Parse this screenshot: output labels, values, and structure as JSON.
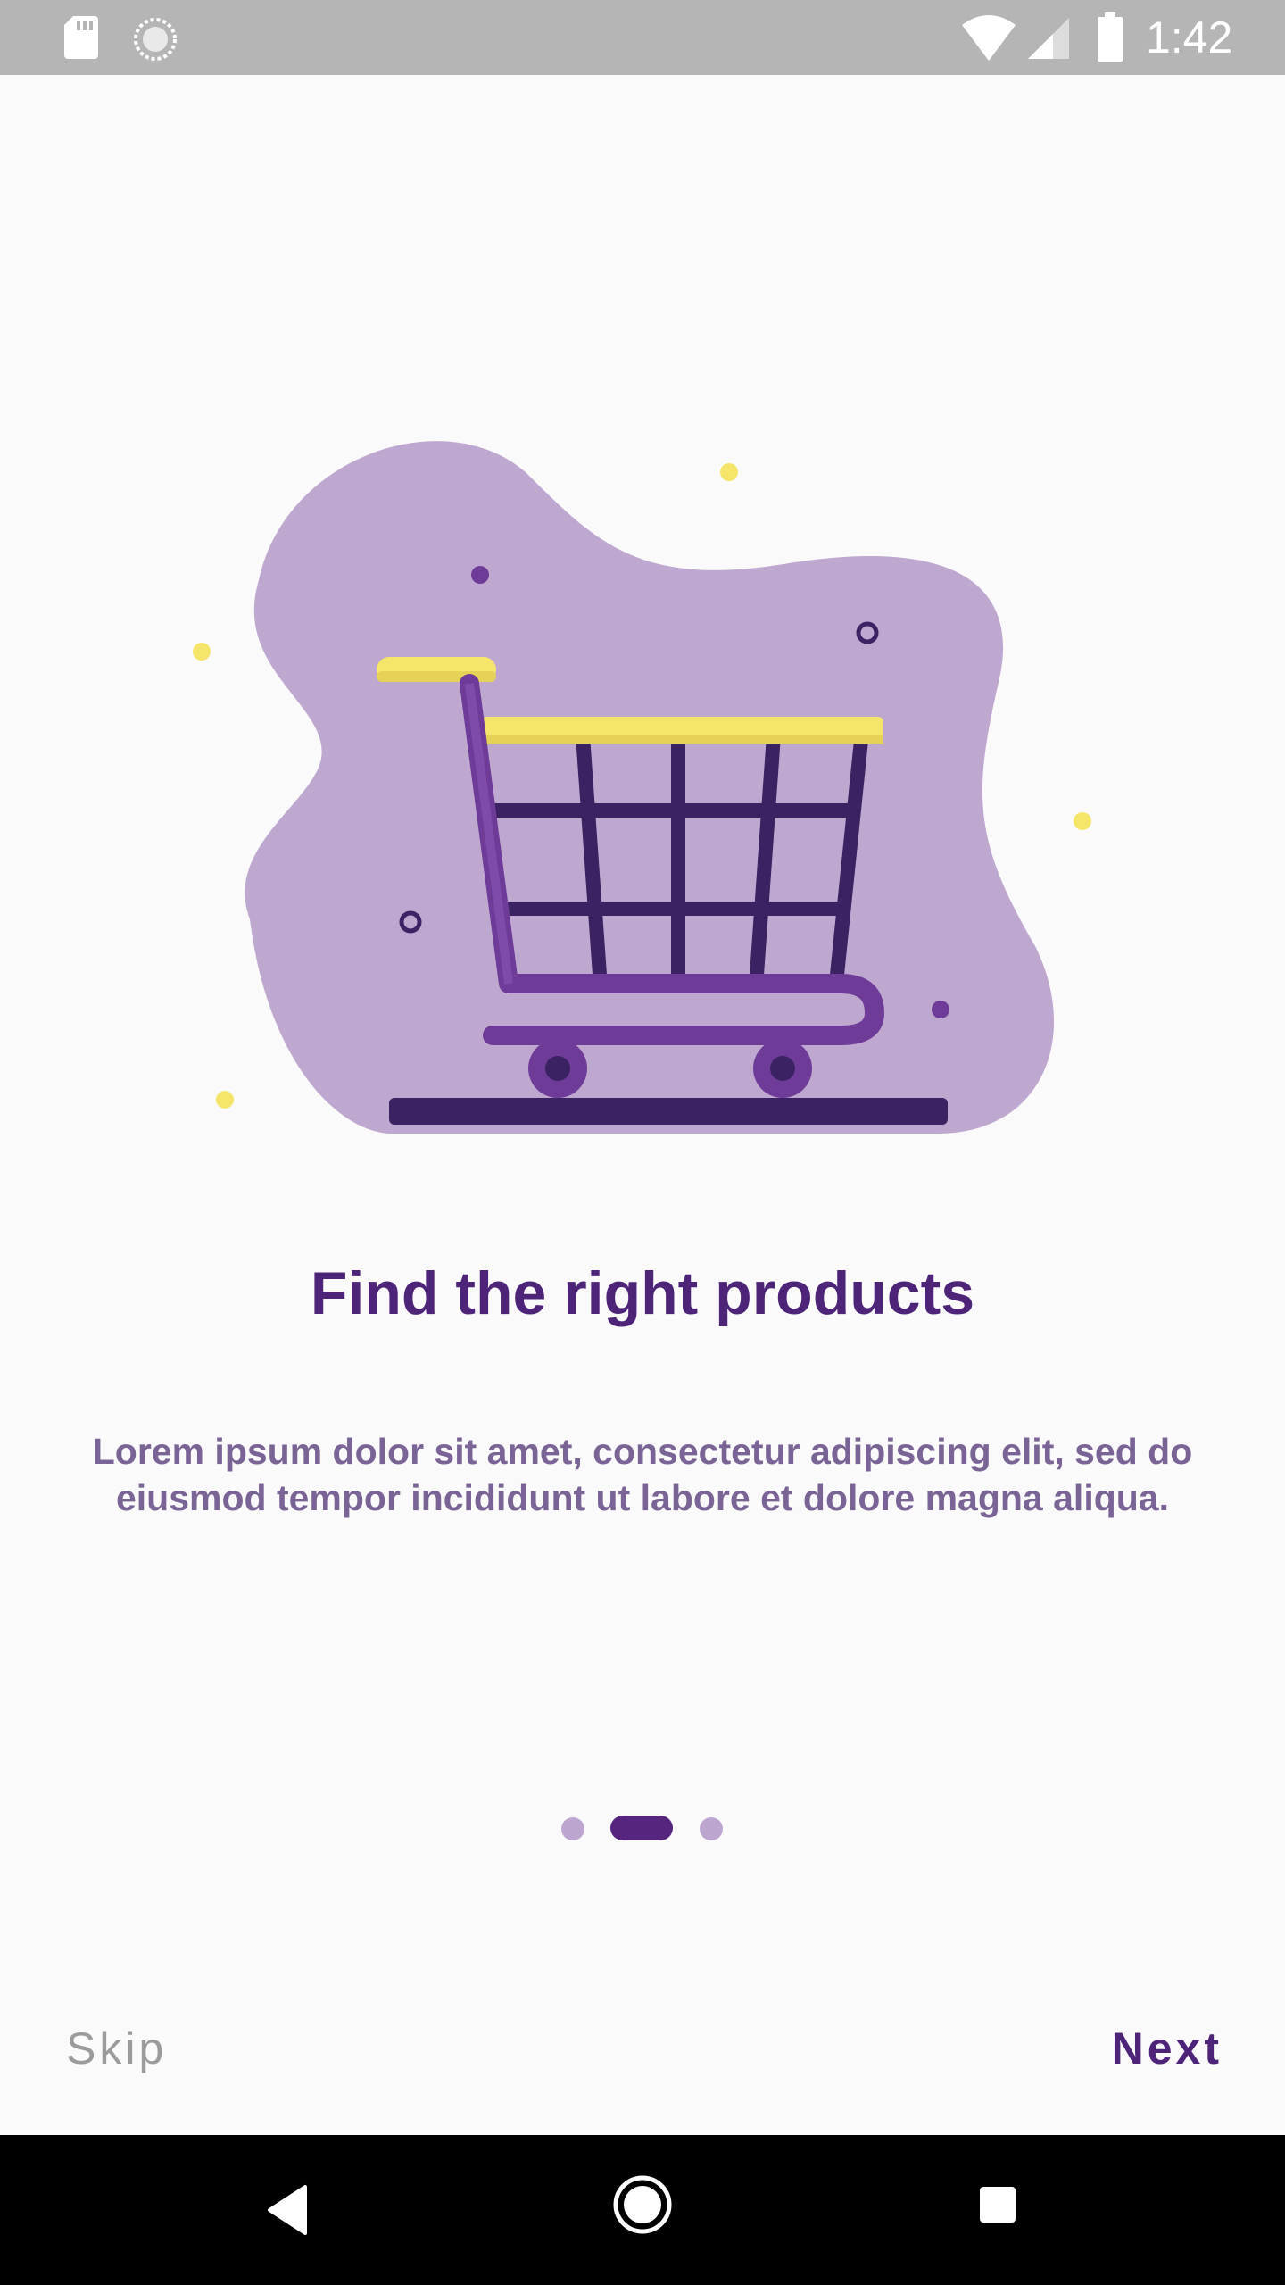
{
  "status_bar": {
    "time": "1:42",
    "icons": [
      "sd-card-icon",
      "sync-icon",
      "wifi-icon",
      "cell-signal-icon",
      "battery-icon"
    ]
  },
  "onboarding": {
    "illustration": "shopping-cart-illustration",
    "title": "Find the right products",
    "description": "Lorem ipsum dolor sit amet, consectetur adipiscing elit, sed do eiusmod tempor incididunt ut labore et dolore magna aliqua.",
    "pages_total": 3,
    "current_page": 2
  },
  "actions": {
    "skip_label": "Skip",
    "next_label": "Next"
  },
  "navigation_bar": {
    "icons": [
      "back-icon",
      "home-icon",
      "recents-icon"
    ]
  },
  "colors": {
    "primary": "#4e2479",
    "accent_yellow": "#f5e56b",
    "blob": "#bfa8d0",
    "status_bar": "#b5b5b5"
  }
}
